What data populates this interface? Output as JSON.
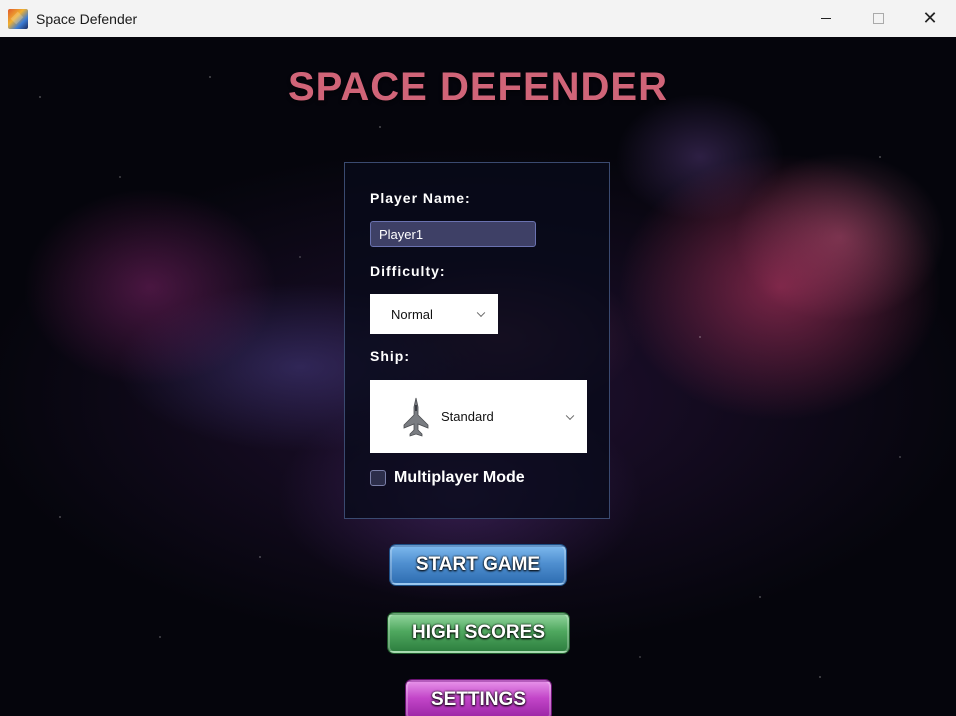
{
  "window": {
    "title": "Space Defender",
    "close_glyph": "✕"
  },
  "game": {
    "title": "SPACE DEFENDER"
  },
  "form": {
    "player_name_label": "Player Name:",
    "player_name_value": "Player1",
    "difficulty_label": "Difficulty:",
    "difficulty_value": "Normal",
    "ship_label": "Ship:",
    "ship_value": "Standard",
    "ship_icon": "fighter-jet-icon",
    "multiplayer_label": "Multiplayer Mode",
    "multiplayer_checked": false
  },
  "buttons": {
    "start": "START GAME",
    "high_scores": "HIGH SCORES",
    "settings": "SETTINGS"
  },
  "colors": {
    "title": "#d06478",
    "start_button": "#4f8fd0",
    "high_scores_button": "#4fa85f",
    "settings_button": "#c245c8"
  }
}
